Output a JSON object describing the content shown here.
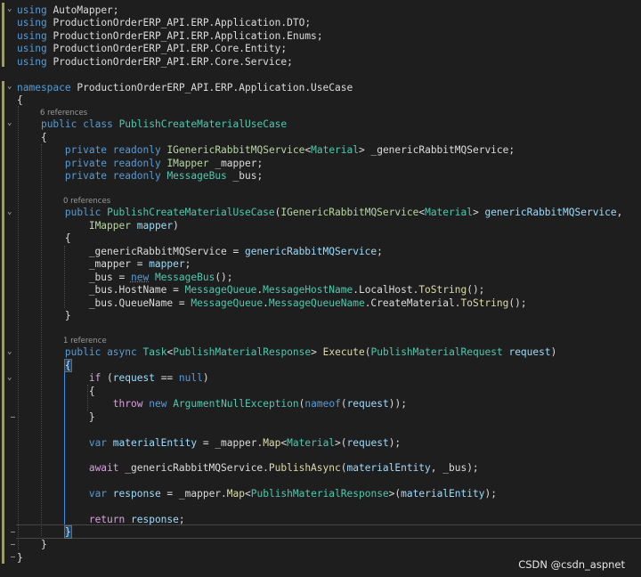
{
  "editor": {
    "codelens": {
      "class_refs": "6 references",
      "ctor_refs": "0 references",
      "method_refs": "1 reference"
    },
    "usings": {
      "u1": "AutoMapper",
      "u2": "ProductionOrderERP_API.ERP.Application.DTO",
      "u3": "ProductionOrderERP_API.ERP.Application.Enums",
      "u4": "ProductionOrderERP_API.ERP.Core.Entity",
      "u5": "ProductionOrderERP_API.ERP.Core.Service"
    },
    "namespace": "ProductionOrderERP_API.ERP.Application.UseCase",
    "class_name": "PublishCreateMaterialUseCase"
  },
  "colors": {
    "background": "#1e1e1e",
    "keyword": "#569cd6",
    "control_keyword": "#d8a0df",
    "type": "#4ec9b0",
    "interface": "#b8d7a3",
    "method": "#dcdcaa",
    "parameter": "#9cdcfe",
    "text": "#dcdcdc"
  },
  "watermark": "CSDN @csdn_aspnet"
}
